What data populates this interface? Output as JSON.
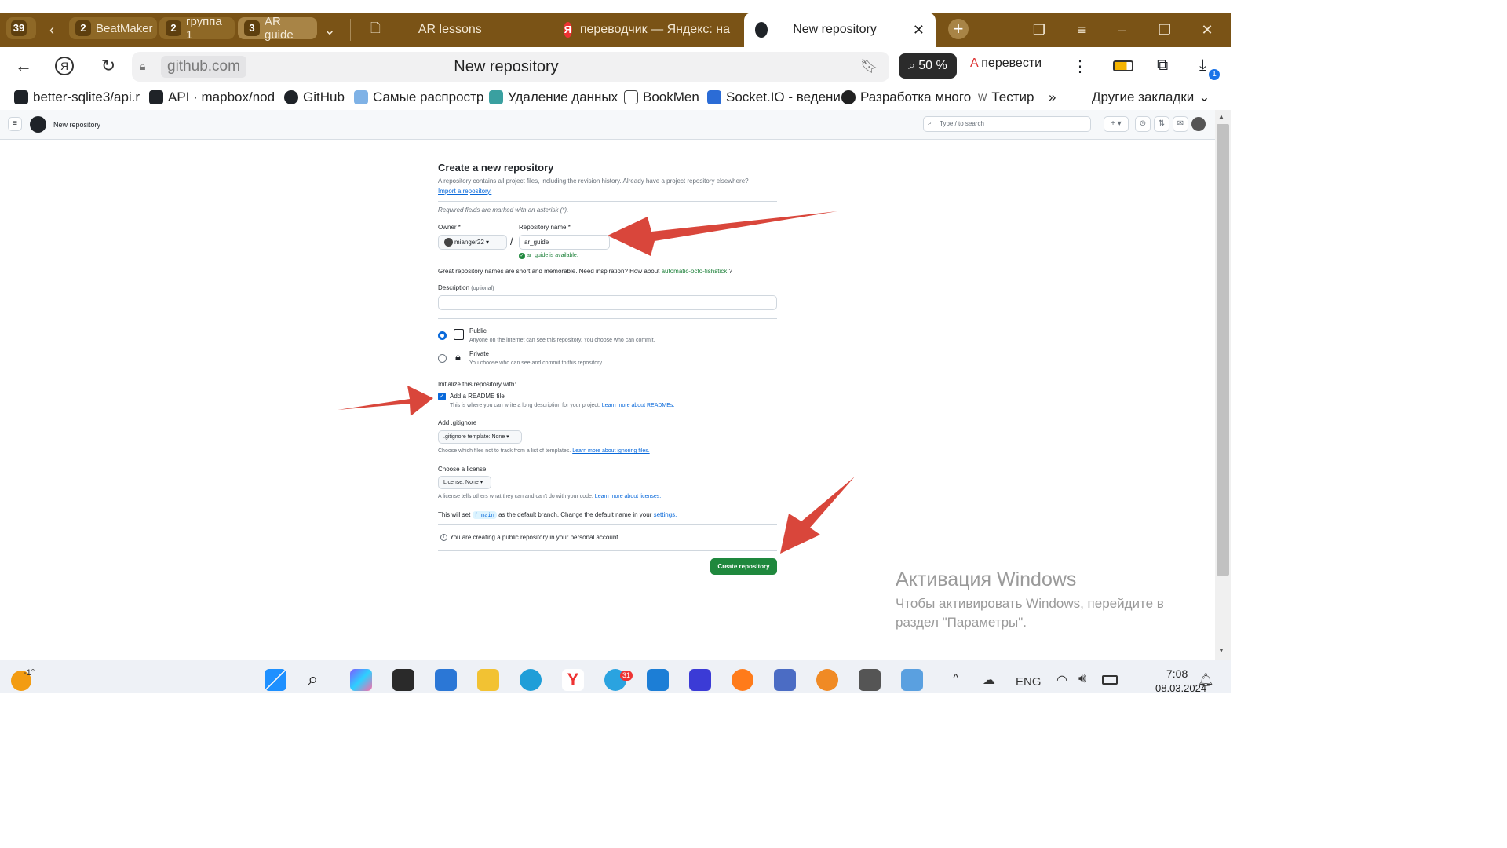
{
  "browser": {
    "tab_count": "39",
    "groups": [
      {
        "num": "2",
        "label": "BeatMaker"
      },
      {
        "num": "2",
        "label": "группа 1"
      },
      {
        "num": "3",
        "label": "AR guide"
      }
    ],
    "tabs": [
      {
        "label": "AR lessons"
      },
      {
        "label": "переводчик — Яндекс: на"
      },
      {
        "label": "New repository"
      }
    ],
    "url_host": "github.com",
    "page_title": "New repository",
    "zoom": "50 %",
    "translate_label": "перевести",
    "download_badge": "1",
    "bookmarks": [
      "better-sqlite3/api.r",
      "API · mapbox/nod",
      "GitHub",
      "Самые распростр",
      "Удаление данных",
      "BookMen",
      "Socket.IO - ведени",
      "Разработка много",
      "Тестир"
    ],
    "other_bookmarks": "Другие закладки"
  },
  "github": {
    "header_title": "New repository",
    "search_placeholder": "Type / to search",
    "form": {
      "heading": "Create a new repository",
      "intro": "A repository contains all project files, including the revision history. Already have a project repository elsewhere?",
      "import_link": "Import a repository.",
      "required_note": "Required fields are marked with an asterisk (*).",
      "owner_label": "Owner *",
      "owner_value": "mianger22",
      "slash": "/",
      "repo_label": "Repository name *",
      "repo_value": "ar_guide",
      "available": "ar_guide is available.",
      "inspiration": "Great repository names are short and memorable. Need inspiration? How about",
      "suggestion": "automatic-octo-fishstick",
      "suggestion_q": "?",
      "description_label": "Description",
      "optional": "(optional)",
      "description_value": "",
      "public_label": "Public",
      "public_desc": "Anyone on the internet can see this repository. You choose who can commit.",
      "private_label": "Private",
      "private_desc": "You choose who can see and commit to this repository.",
      "init_label": "Initialize this repository with:",
      "readme_label": "Add a README file",
      "readme_desc": "This is where you can write a long description for your project.",
      "readme_link": "Learn more about READMEs.",
      "gitignore_label": "Add .gitignore",
      "gitignore_value": ".gitignore template: None",
      "gitignore_desc": "Choose which files not to track from a list of templates.",
      "gitignore_link": "Learn more about ignoring files.",
      "license_label": "Choose a license",
      "license_value": "License: None",
      "license_desc": "A license tells others what they can and can't do with your code.",
      "license_link": "Learn more about licenses.",
      "branch_pre": "This will set",
      "branch_name": "main",
      "branch_post": "as the default branch. Change the default name in your",
      "settings_link": "settings.",
      "public_notice": "You are creating a public repository in your personal account.",
      "create_button": "Create repository"
    }
  },
  "watermark": {
    "title": "Активация Windows",
    "body": "Чтобы активировать Windows, перейдите в раздел \"Параметры\"."
  },
  "taskbar": {
    "weather": "-1°",
    "telegram_badge": "31",
    "lang": "ENG",
    "time": "7:08",
    "date": "08.03.2024"
  },
  "colors": {
    "accent_green": "#1f883d",
    "link_blue": "#0969da",
    "arrow_red": "#d9463b",
    "tabbar_brown": "#7a5316"
  }
}
